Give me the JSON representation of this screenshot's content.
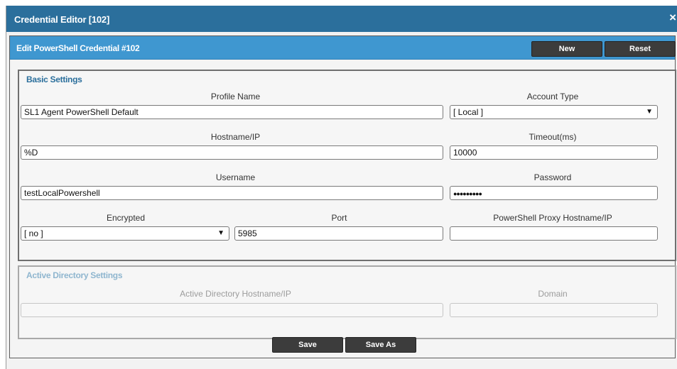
{
  "window": {
    "title": "Credential Editor [102]",
    "close_glyph": "×"
  },
  "panel": {
    "title": "Edit PowerShell Credential #102",
    "new_label": "New",
    "reset_label": "Reset"
  },
  "basic": {
    "legend": "Basic Settings",
    "profile_name": {
      "label": "Profile Name",
      "value": "SL1 Agent PowerShell Default"
    },
    "account_type": {
      "label": "Account Type",
      "value": "[ Local ]"
    },
    "hostname": {
      "label": "Hostname/IP",
      "value": "%D"
    },
    "timeout": {
      "label": "Timeout(ms)",
      "value": "10000"
    },
    "username": {
      "label": "Username",
      "value": "testLocalPowershell"
    },
    "password": {
      "label": "Password",
      "value": "●●●●●●●●●"
    },
    "encrypted": {
      "label": "Encrypted",
      "value": "[ no ]"
    },
    "port": {
      "label": "Port",
      "value": "5985"
    },
    "proxy": {
      "label": "PowerShell Proxy Hostname/IP",
      "value": ""
    }
  },
  "ad": {
    "legend": "Active Directory Settings",
    "hostname": {
      "label": "Active Directory Hostname/IP",
      "value": ""
    },
    "domain": {
      "label": "Domain",
      "value": ""
    }
  },
  "footer": {
    "save_label": "Save",
    "save_as_label": "Save As"
  },
  "icons": {
    "dropdown": "▼"
  },
  "colors": {
    "titlebar": "#2b6f9c",
    "panel_header": "#3f97d0",
    "button": "#3c3c3c"
  }
}
